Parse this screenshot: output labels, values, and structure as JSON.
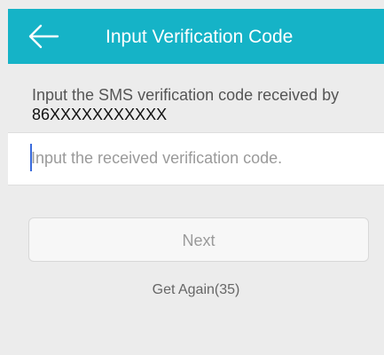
{
  "header": {
    "title": "Input Verification Code",
    "back_icon": "back-arrow-icon",
    "background_color": "#15b3c7"
  },
  "instruction": {
    "text": "Input the SMS verification code received by ",
    "phone": "86XXXXXXXXXXX"
  },
  "code_input": {
    "value": "",
    "placeholder": "Input the received verification code."
  },
  "next_button": {
    "label": "Next",
    "state": "disabled"
  },
  "get_again": {
    "label": "Get Again(35)"
  }
}
